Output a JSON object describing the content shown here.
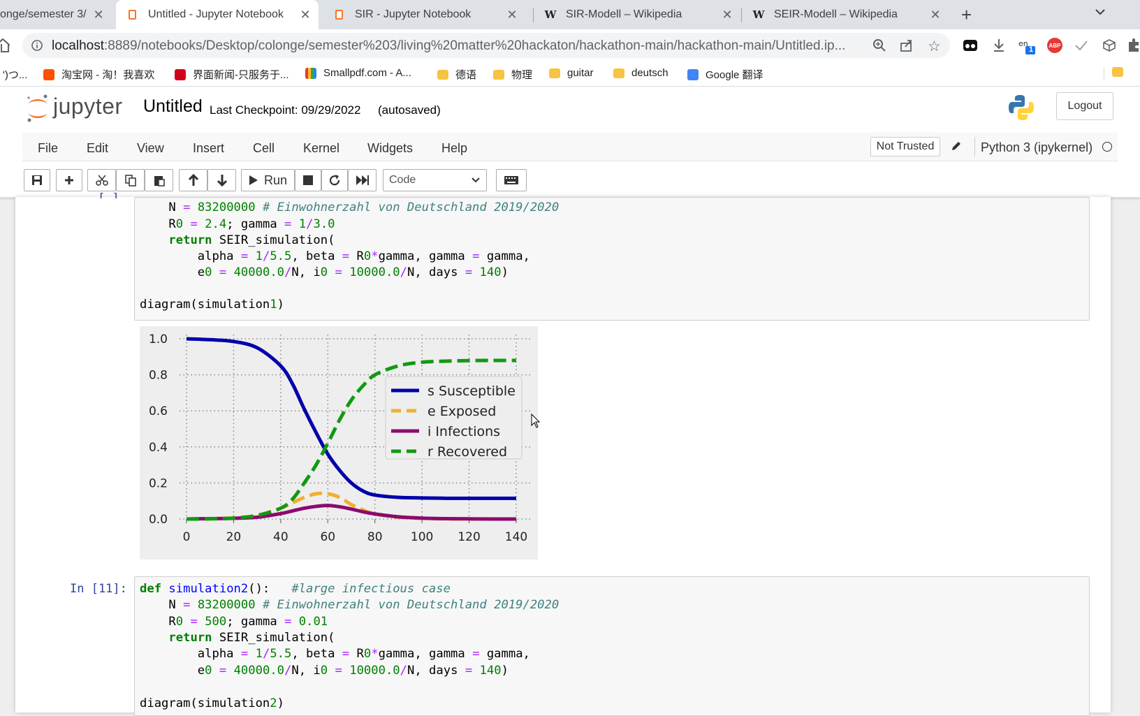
{
  "browser": {
    "tabs": [
      {
        "title": "onge/semester 3/"
      },
      {
        "title": "Untitled - Jupyter Notebook"
      },
      {
        "title": "SIR - Jupyter Notebook"
      },
      {
        "title": "SIR-Modell – Wikipedia"
      },
      {
        "title": "SEIR-Modell – Wikipedia"
      }
    ],
    "url_host": "localhost",
    "url_path": ":8889/notebooks/Desktop/colonge/semester%203/living%20matter%20hackaton/hackathon-main/hackathon-main/Untitled.ip...",
    "extension_badge": "1",
    "abp": "ABP",
    "bookmarks": [
      {
        "label": "')つ...",
        "color": ""
      },
      {
        "label": "淘宝网 - 淘！我喜欢",
        "color": "#ff5000"
      },
      {
        "label": "界面新闻-只服务于...",
        "color": "#d0021b"
      },
      {
        "label": "Smallpdf.com - A...",
        "color": "#e53935"
      },
      {
        "label": "德语",
        "color": "folder"
      },
      {
        "label": "物理",
        "color": "folder"
      },
      {
        "label": "guitar",
        "color": "folder"
      },
      {
        "label": "deutsch",
        "color": "folder"
      },
      {
        "label": "Google 翻译",
        "color": "#4285f4"
      }
    ]
  },
  "jupyter": {
    "logo_text": "jupyter",
    "notebook_name": "Untitled",
    "checkpoint": "Last Checkpoint: 09/29/2022",
    "autosaved": "(autosaved)",
    "logout": "Logout",
    "menu": [
      "File",
      "Edit",
      "View",
      "Insert",
      "Cell",
      "Kernel",
      "Widgets",
      "Help"
    ],
    "not_trusted": "Not Trusted",
    "kernel_name": "Python 3 (ipykernel)",
    "run_label": "Run",
    "cell_type": "Code",
    "partial_prompt": "[ ]"
  },
  "cells": {
    "cell1_lines": [
      "    N = 83200000 # Einwohnerzahl von Deutschland 2019/2020",
      "    R0 = 2.4; gamma = 1/3.0",
      "    return SEIR_simulation(",
      "        alpha = 1/5.5, beta = R0*gamma, gamma = gamma,",
      "        e0 = 40000.0/N, i0 = 10000.0/N, days = 140)",
      "",
      "diagram(simulation1)"
    ],
    "cell2_prompt": "In [11]:",
    "cell2_lines": [
      "def simulation2():   #large infectious case",
      "    N = 83200000 # Einwohnerzahl von Deutschland 2019/2020",
      "    R0 = 500; gamma = 0.01",
      "    return SEIR_simulation(",
      "        alpha = 1/5.5, beta = R0*gamma, gamma = gamma,",
      "        e0 = 40000.0/N, i0 = 10000.0/N, days = 140)",
      "",
      "diagram(simulation2)"
    ]
  },
  "chart_data": {
    "type": "line",
    "title": "",
    "xlabel": "",
    "ylabel": "",
    "xlim": [
      0,
      140
    ],
    "ylim": [
      0,
      1.0
    ],
    "xticks": [
      "0",
      "20",
      "40",
      "60",
      "80",
      "100",
      "120",
      "140"
    ],
    "yticks": [
      "0.0",
      "0.2",
      "0.4",
      "0.6",
      "0.8",
      "1.0"
    ],
    "grid": true,
    "legend_position": "center-right",
    "x": [
      0,
      10,
      20,
      30,
      40,
      45,
      50,
      55,
      60,
      65,
      70,
      75,
      80,
      90,
      100,
      110,
      120,
      130,
      140
    ],
    "series": [
      {
        "name": "s Susceptible",
        "color": "#0000aa",
        "style": "solid",
        "values": [
          1.0,
          0.995,
          0.985,
          0.95,
          0.85,
          0.75,
          0.61,
          0.48,
          0.36,
          0.27,
          0.2,
          0.155,
          0.133,
          0.12,
          0.117,
          0.115,
          0.115,
          0.115,
          0.115
        ]
      },
      {
        "name": "e Exposed",
        "color": "#f0b030",
        "style": "dashed",
        "values": [
          0.0,
          0.002,
          0.006,
          0.02,
          0.06,
          0.09,
          0.12,
          0.14,
          0.14,
          0.12,
          0.08,
          0.05,
          0.028,
          0.01,
          0.004,
          0.001,
          0.0,
          0.0,
          0.0
        ]
      },
      {
        "name": "i Infections",
        "color": "#8b0a6e",
        "style": "solid",
        "values": [
          0.0,
          0.002,
          0.004,
          0.01,
          0.03,
          0.045,
          0.06,
          0.07,
          0.075,
          0.068,
          0.055,
          0.04,
          0.028,
          0.012,
          0.005,
          0.002,
          0.001,
          0.0,
          0.0
        ]
      },
      {
        "name": "r Recovered",
        "color": "#119911",
        "style": "dashed",
        "values": [
          0.0,
          0.001,
          0.005,
          0.02,
          0.06,
          0.11,
          0.2,
          0.3,
          0.42,
          0.55,
          0.66,
          0.74,
          0.8,
          0.85,
          0.87,
          0.876,
          0.879,
          0.88,
          0.88
        ]
      }
    ]
  }
}
